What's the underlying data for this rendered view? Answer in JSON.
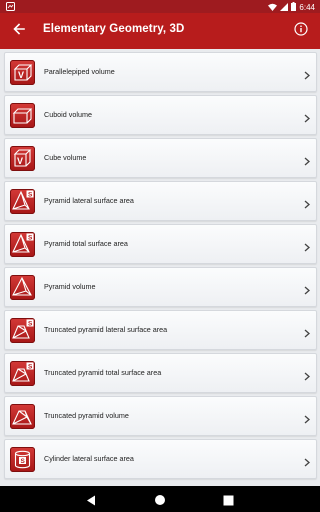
{
  "status_bar": {
    "time": "6:44"
  },
  "app_bar": {
    "title": "Elementary Geometry, 3D",
    "back_icon": "arrow-back-icon",
    "info_icon": "info-icon"
  },
  "items": [
    {
      "label": "Parallelepiped volume",
      "icon": "parallelepiped-volume-icon"
    },
    {
      "label": "Cuboid volume",
      "icon": "cuboid-icon"
    },
    {
      "label": "Cube volume",
      "icon": "cube-volume-icon"
    },
    {
      "label": "Pyramid lateral surface area",
      "icon": "pyramid-surface-icon"
    },
    {
      "label": "Pyramid total surface area",
      "icon": "pyramid-surface-icon"
    },
    {
      "label": "Pyramid volume",
      "icon": "pyramid-icon"
    },
    {
      "label": "Truncated pyramid lateral surface area",
      "icon": "truncated-pyramid-surface-icon"
    },
    {
      "label": "Truncated pyramid total surface area",
      "icon": "truncated-pyramid-surface-icon"
    },
    {
      "label": "Truncated pyramid volume",
      "icon": "truncated-pyramid-icon"
    },
    {
      "label": "Cylinder lateral surface area",
      "icon": "cylinder-surface-icon"
    }
  ],
  "colors": {
    "primary": "#b71c1c",
    "status": "#9e1b1f",
    "background": "#e9ebee"
  }
}
